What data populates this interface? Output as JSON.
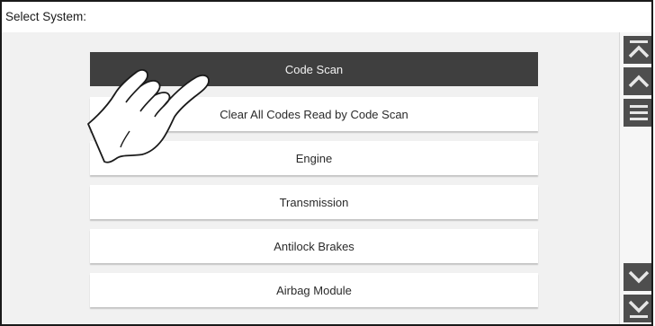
{
  "header": {
    "title": "Select System:"
  },
  "menu": {
    "items": [
      {
        "label": "Code Scan",
        "selected": true
      },
      {
        "label": "Clear All Codes Read by Code Scan",
        "selected": false
      },
      {
        "label": "Engine",
        "selected": false
      },
      {
        "label": "Transmission",
        "selected": false
      },
      {
        "label": "Antilock Brakes",
        "selected": false
      },
      {
        "label": "Airbag Module",
        "selected": false
      }
    ]
  },
  "scrollbar": {
    "buttons": [
      {
        "name": "page-up",
        "icon": "double-chevron-up-icon"
      },
      {
        "name": "line-up",
        "icon": "chevron-up-icon"
      },
      {
        "name": "menu",
        "icon": "hamburger-icon"
      },
      {
        "name": "line-down",
        "icon": "chevron-down-icon"
      },
      {
        "name": "page-down",
        "icon": "double-chevron-down-icon"
      }
    ]
  },
  "colors": {
    "selected_bg": "#3f3f3f",
    "list_bg": "#f1f1f1",
    "button_bg": "#4e4e4e"
  },
  "annotation": {
    "icon": "pointing-hand-icon"
  }
}
